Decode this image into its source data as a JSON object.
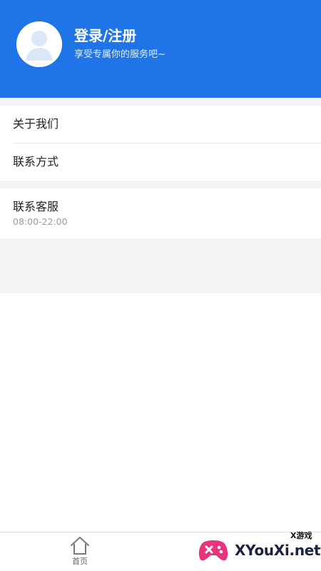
{
  "header": {
    "login_title": "登录/注册",
    "login_subtitle": "享受专属你的服务吧~",
    "background_color": "#1f75e8"
  },
  "menu": {
    "about_us": "关于我们",
    "contact_info": "联系方式",
    "customer_service": "联系客服",
    "service_hours": "08:00-22:00"
  },
  "tabbar": {
    "home_label": "首页",
    "home_icon": "home-icon"
  },
  "watermark": {
    "brand": "XYouXi.net",
    "tag": "X游戏",
    "logo_icon": "gamepad-icon"
  }
}
